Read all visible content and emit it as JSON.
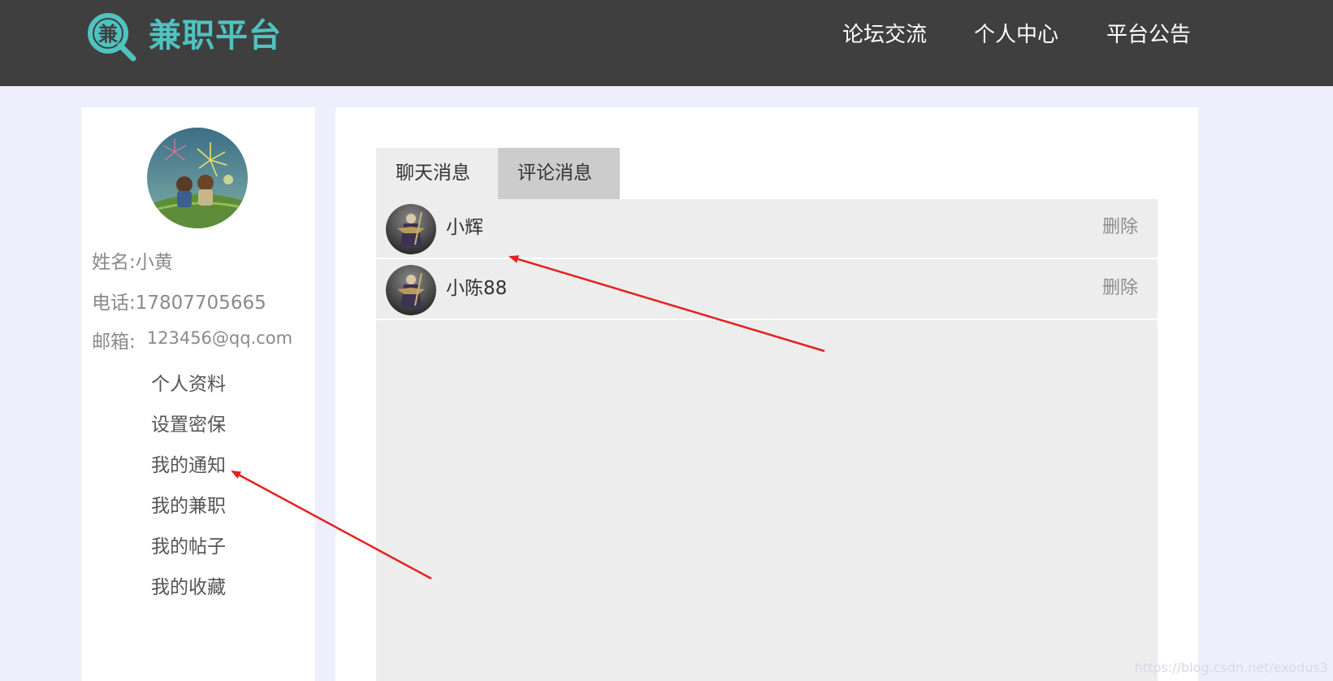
{
  "header": {
    "logo_glyph": "兼",
    "logo_text": "兼职平台",
    "nav": {
      "forum": "论坛交流",
      "profile": "个人中心",
      "notice": "平台公告"
    }
  },
  "sidebar": {
    "name_label": "姓名:",
    "name_value": "小黄",
    "phone_label": "电话:",
    "phone_value": "17807705665",
    "email_label": "邮箱:",
    "email_value": "123456@qq.com",
    "menu": [
      "个人资料",
      "设置密保",
      "我的通知",
      "我的兼职",
      "我的帖子",
      "我的收藏"
    ]
  },
  "main": {
    "tabs": {
      "chat": "聊天消息",
      "comment": "评论消息"
    },
    "messages": [
      {
        "name": "小辉",
        "delete": "删除"
      },
      {
        "name": "小陈88",
        "delete": "删除"
      }
    ]
  },
  "watermark": "https://blog.csdn.net/exodus3",
  "colors": {
    "header_bg": "#3f3f3f",
    "brand": "#4fc3c0",
    "page_bg": "#eeeefc",
    "annotation_arrow": "#e52222"
  }
}
